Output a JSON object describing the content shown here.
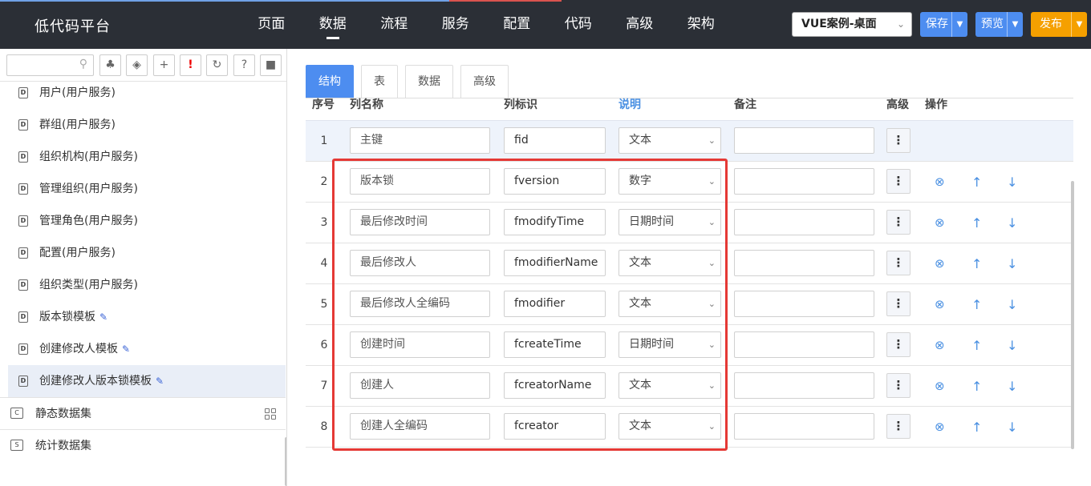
{
  "app": {
    "title": "低代码平台"
  },
  "nav": [
    {
      "label": "页面"
    },
    {
      "label": "数据",
      "active": true
    },
    {
      "label": "流程"
    },
    {
      "label": "服务"
    },
    {
      "label": "配置"
    },
    {
      "label": "代码"
    },
    {
      "label": "高级"
    },
    {
      "label": "架构"
    }
  ],
  "project_select": {
    "value": "VUE案例-桌面"
  },
  "toolbar": {
    "save_label": "保存",
    "preview_label": "预览",
    "publish_label": "发布"
  },
  "sidebar": {
    "search": {
      "value": "",
      "placeholder": ""
    },
    "tools": [
      "tree-icon",
      "tag-icon",
      "plus-icon",
      "exclamation-icon",
      "refresh-icon",
      "help-icon",
      "comment-icon"
    ],
    "items": [
      {
        "label": "用户(用户服务)",
        "editable": false
      },
      {
        "label": "群组(用户服务)",
        "editable": false
      },
      {
        "label": "组织机构(用户服务)",
        "editable": false
      },
      {
        "label": "管理组织(用户服务)",
        "editable": false
      },
      {
        "label": "管理角色(用户服务)",
        "editable": false
      },
      {
        "label": "配置(用户服务)",
        "editable": false
      },
      {
        "label": "组织类型(用户服务)",
        "editable": false
      },
      {
        "label": "版本锁模板",
        "editable": true
      },
      {
        "label": "创建修改人模板",
        "editable": true
      },
      {
        "label": "创建修改人版本锁模板",
        "editable": true,
        "active": true
      }
    ],
    "groups": [
      {
        "label": "静态数据集",
        "icon_letter": "C"
      },
      {
        "label": "统计数据集",
        "icon_letter": "S"
      }
    ],
    "file_icon_letter": "D"
  },
  "tabs": [
    {
      "label": "结构",
      "active": true
    },
    {
      "label": "表"
    },
    {
      "label": "数据"
    },
    {
      "label": "高级"
    }
  ],
  "columns": {
    "no": "序号",
    "name": "列名称",
    "code": "列标识",
    "desc": "说明",
    "note": "备注",
    "adv": "高级",
    "ops": "操作"
  },
  "rows": [
    {
      "no": "1",
      "name": "主键",
      "code": "fid",
      "type": "文本",
      "note": ""
    },
    {
      "no": "2",
      "name": "版本锁",
      "code": "fversion",
      "type": "数字",
      "note": ""
    },
    {
      "no": "3",
      "name": "最后修改时间",
      "code": "fmodifyTime",
      "type": "日期时间",
      "note": ""
    },
    {
      "no": "4",
      "name": "最后修改人",
      "code": "fmodifierName",
      "type": "文本",
      "note": ""
    },
    {
      "no": "5",
      "name": "最后修改人全编码",
      "code": "fmodifier",
      "type": "文本",
      "note": ""
    },
    {
      "no": "6",
      "name": "创建时间",
      "code": "fcreateTime",
      "type": "日期时间",
      "note": ""
    },
    {
      "no": "7",
      "name": "创建人",
      "code": "fcreatorName",
      "type": "文本",
      "note": ""
    },
    {
      "no": "8",
      "name": "创建人全编码",
      "code": "fcreator",
      "type": "文本",
      "note": ""
    }
  ],
  "colors": {
    "primary": "#4d8df0",
    "publish": "#f5a000",
    "topbar": "#2b2f36",
    "highlight": "#e53935"
  }
}
